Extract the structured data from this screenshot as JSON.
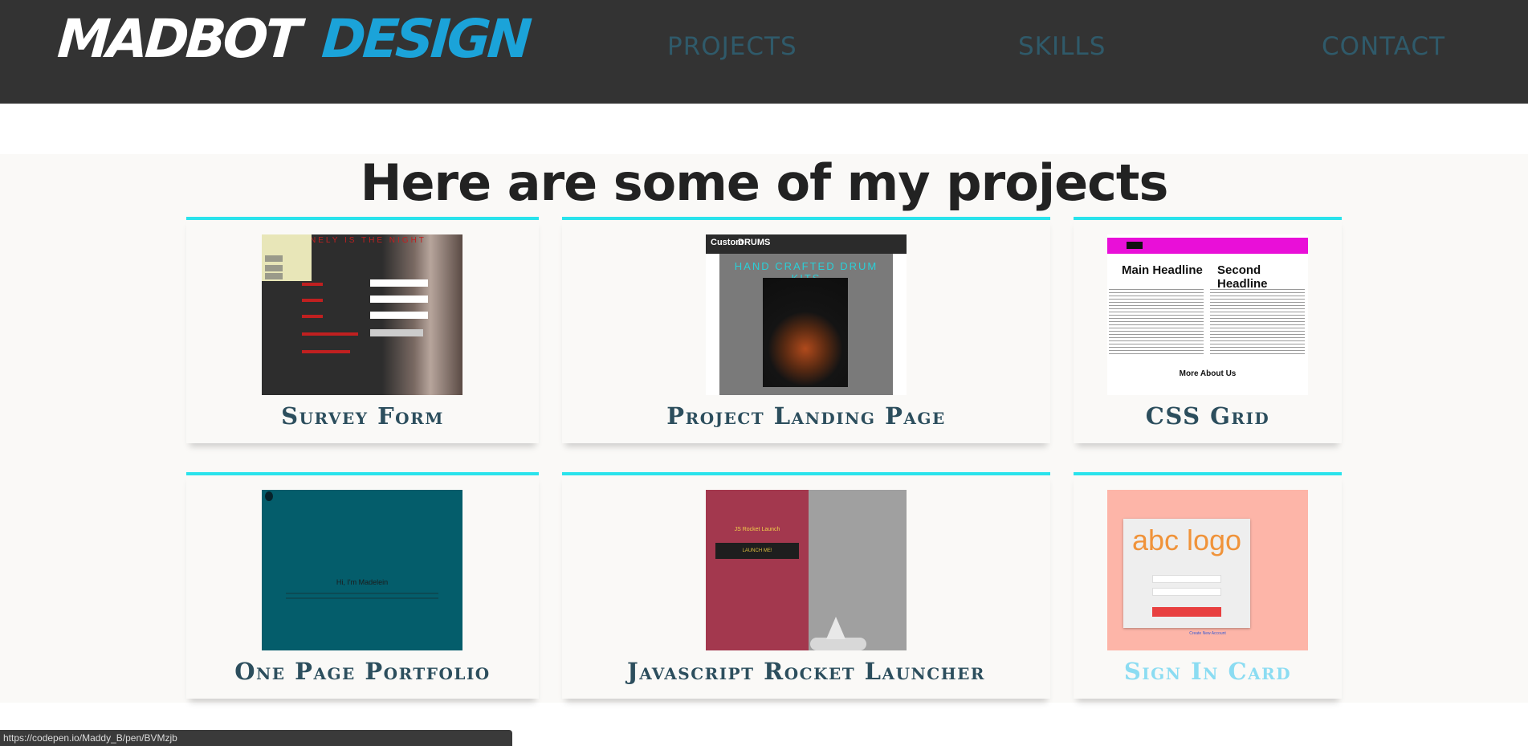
{
  "navbar": {
    "logo_part1": "MADBOT",
    "logo_part2": "DESIGN",
    "links": [
      "PROJECTS",
      "SKILLS",
      "CONTACT"
    ]
  },
  "projects": {
    "title": "Here are some of my projects",
    "cards": [
      {
        "label": "Survey Form",
        "thumbnail": "survey-form-screenshot"
      },
      {
        "label": "Project Landing Page",
        "thumbnail": "drum-landing-screenshot"
      },
      {
        "label": "CSS Grid",
        "thumbnail": "css-grid-screenshot"
      },
      {
        "label": "One Page Portfolio",
        "thumbnail": "portfolio-screenshot"
      },
      {
        "label": "Javascript Rocket Launcher",
        "thumbnail": "rocket-launcher-screenshot"
      },
      {
        "label": "Sign In Card",
        "thumbnail": "sign-in-screenshot"
      }
    ]
  },
  "thumbs": {
    "survey_title": "NELY IS THE NIGHT",
    "drums_brand_1": "Custom",
    "drums_brand_2": "DRUMS",
    "drums_heading": "HAND CRAFTED DRUM KITS",
    "grid_h1": "Main Headline",
    "grid_h2": "Second Headline",
    "grid_about": "More About Us",
    "portfolio_hi": "Hi, I'm Madelein",
    "rocket_title": "JS Rocket Launch",
    "rocket_button": "LAUNCH ME!",
    "signin_logo": "abc logo",
    "signin_link": "Create New Account"
  },
  "status_bar": {
    "url": "https://codepen.io/Maddy_B/pen/BVMzjb"
  },
  "colors": {
    "navbar_bg": "#333333",
    "logo_accent": "#1ba3d9",
    "card_accent_line": "#29e3ec",
    "card_label": "#2c4e5d",
    "card_label_hover": "#8bdcf2"
  }
}
